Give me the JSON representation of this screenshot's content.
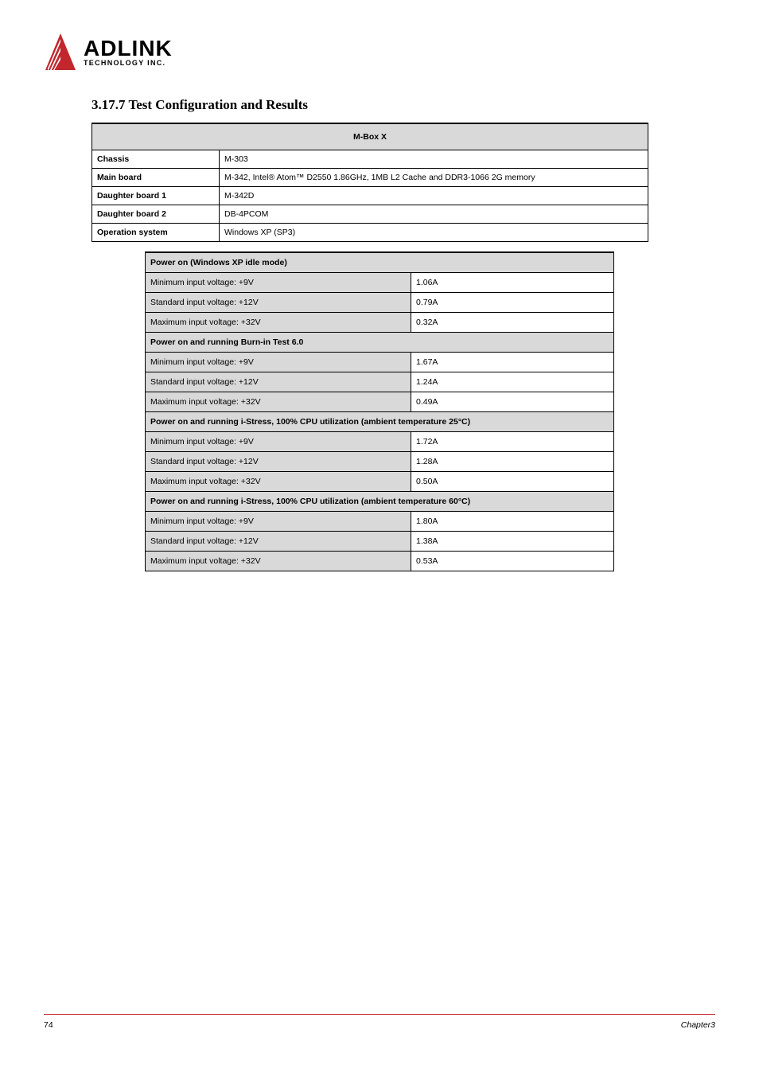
{
  "logo": {
    "main": "ADLINK",
    "sub": "TECHNOLOGY INC."
  },
  "section_heading": "3.17.7 Test Configuration and Results",
  "mbox": {
    "header": "M-Box X",
    "rows": [
      {
        "label": "Chassis",
        "value": "M-303"
      },
      {
        "label": "Main board",
        "value": "M-342, Intel® Atom™ D2550 1.86GHz, 1MB L2 Cache and DDR3-1066 2G memory"
      },
      {
        "label": "Daughter board 1",
        "value": "M-342D"
      },
      {
        "label": "Daughter board 2",
        "value": "DB-4PCOM"
      },
      {
        "label": "Operation system",
        "value": "Windows XP (SP3)"
      }
    ]
  },
  "power": {
    "sections": [
      {
        "title": "Power on (Windows XP idle mode)",
        "rows": [
          {
            "param": "Minimum input voltage: +9V",
            "value": "1.06A"
          },
          {
            "param": "Standard input voltage: +12V",
            "value": "0.79A"
          },
          {
            "param": "Maximum input voltage: +32V",
            "value": "0.32A"
          }
        ]
      },
      {
        "title": "Power on and running Burn-in Test 6.0",
        "rows": [
          {
            "param": "Minimum input voltage: +9V",
            "value": "1.67A"
          },
          {
            "param": "Standard input voltage: +12V",
            "value": "1.24A"
          },
          {
            "param": "Maximum input voltage: +32V",
            "value": "0.49A"
          }
        ]
      },
      {
        "title": "Power on and running i-Stress, 100% CPU utilization (ambient temperature 25°C)",
        "rows": [
          {
            "param": "Minimum input voltage: +9V",
            "value": "1.72A"
          },
          {
            "param": "Standard input voltage: +12V",
            "value": "1.28A"
          },
          {
            "param": "Maximum input voltage: +32V",
            "value": "0.50A"
          }
        ]
      },
      {
        "title": "Power on and running i-Stress, 100% CPU utilization (ambient temperature 60°C)",
        "rows": [
          {
            "param": "Minimum input voltage: +9V",
            "value": "1.80A"
          },
          {
            "param": "Standard input voltage: +12V",
            "value": "1.38A"
          },
          {
            "param": "Maximum input voltage: +32V",
            "value": "0.53A"
          }
        ]
      }
    ]
  },
  "footer": {
    "page": "74",
    "chapter": "Chapter3"
  }
}
